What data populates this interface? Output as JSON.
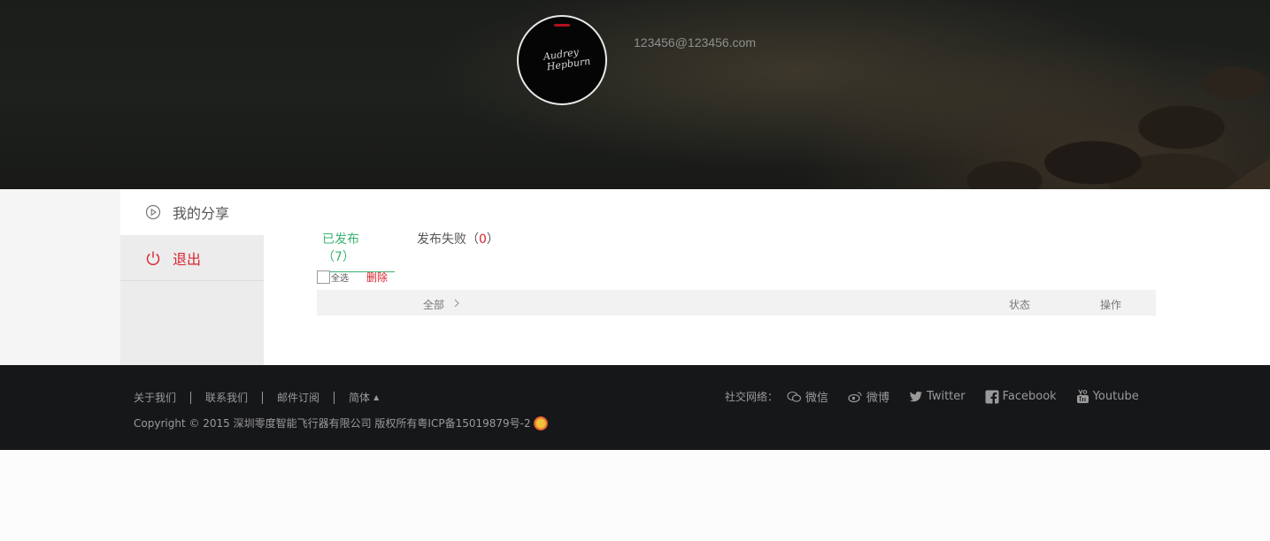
{
  "header": {
    "email": "123456@123456.com",
    "avatar_signature": [
      "Audrey",
      "Hepburn"
    ]
  },
  "sidebar": {
    "items": [
      {
        "label": "我的分享",
        "icon": "play-circle-icon"
      },
      {
        "label": "退出",
        "icon": "power-icon"
      }
    ]
  },
  "tabs": [
    {
      "label": "已发布",
      "open": "（",
      "count": "7",
      "close": "）"
    },
    {
      "label": "发布失败",
      "open": "（",
      "count": "0",
      "close": "）"
    }
  ],
  "toolbar": {
    "select_all": "全选",
    "delete": "删除"
  },
  "table": {
    "col_all": "全部",
    "col_status": "状态",
    "col_action": "操作"
  },
  "footer": {
    "links": [
      "关于我们",
      "联系我们",
      "邮件订阅"
    ],
    "language": "简体",
    "copyright": "Copyright © 2015 深圳零度智能飞行器有限公司 版权所有粤ICP备15019879号-2",
    "social_label": "社交网络：",
    "social": [
      {
        "label": "微信",
        "icon": "wechat-icon"
      },
      {
        "label": "微博",
        "icon": "weibo-icon"
      },
      {
        "label": "Twitter",
        "icon": "twitter-icon"
      },
      {
        "label": "Facebook",
        "icon": "facebook-icon"
      },
      {
        "label": "Youtube",
        "icon": "youtube-icon"
      }
    ]
  },
  "colors": {
    "accent_green": "#3cb371",
    "accent_red": "#d9232d",
    "footer_bg": "#161719"
  }
}
